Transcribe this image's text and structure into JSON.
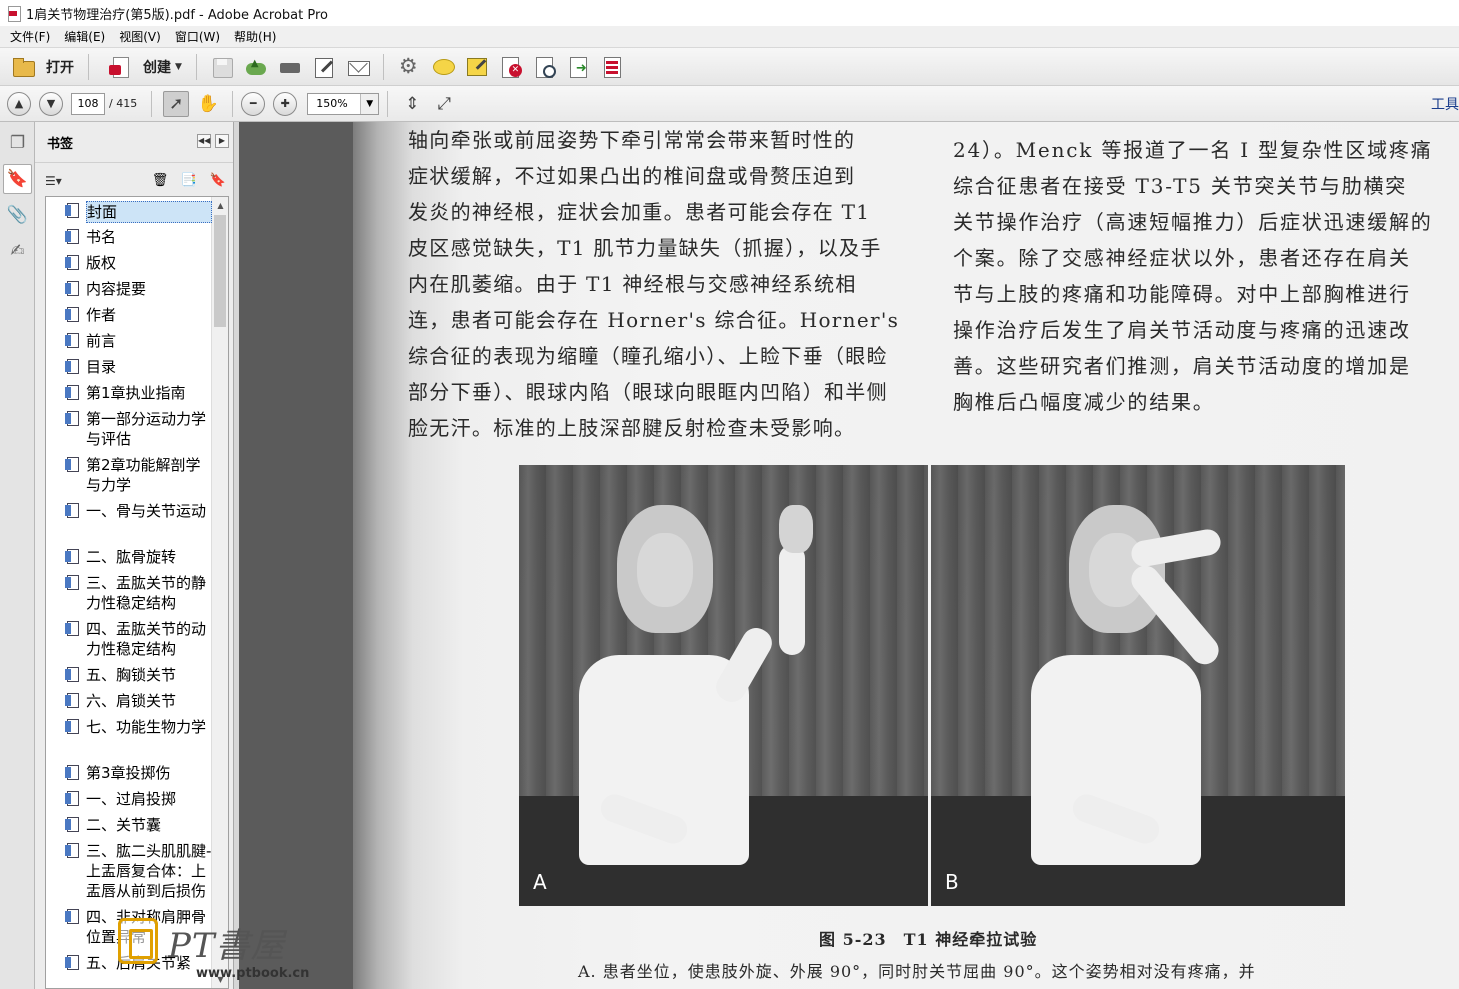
{
  "window": {
    "title": "1肩关节物理治疗(第5版).pdf - Adobe Acrobat Pro"
  },
  "menu": [
    "文件(F)",
    "编辑(E)",
    "视图(V)",
    "窗口(W)",
    "帮助(H)"
  ],
  "toolbar1": {
    "open_label": "打开",
    "create_label": "创建",
    "icons": [
      "save-icon",
      "cloud-upload-icon",
      "print-icon",
      "edit-icon",
      "mail-icon",
      "gear-icon",
      "comment-icon",
      "highlight-icon",
      "redact-icon",
      "search-doc-icon",
      "export-icon",
      "form-icon"
    ]
  },
  "toolbar2": {
    "page_current": "108",
    "page_total": "/ 415",
    "zoom": "150%",
    "tools_label": "工具"
  },
  "sidebar": {
    "title": "书签",
    "bookmarks": [
      {
        "label": "封面",
        "selected": true
      },
      {
        "label": "书名"
      },
      {
        "label": "版权"
      },
      {
        "label": "内容提要"
      },
      {
        "label": "作者"
      },
      {
        "label": "前言"
      },
      {
        "label": "目录"
      },
      {
        "label": "第1章执业指南"
      },
      {
        "label": "第一部分运动力学与评估"
      },
      {
        "label": "第2章功能解剖学与力学"
      },
      {
        "label": "一、骨与关节运动"
      },
      {
        "label": "二、肱骨旋转"
      },
      {
        "label": "三、盂肱关节的静力性稳定结构"
      },
      {
        "label": "四、盂肱关节的动力性稳定结构"
      },
      {
        "label": "五、胸锁关节"
      },
      {
        "label": "六、肩锁关节"
      },
      {
        "label": "七、功能生物力学"
      },
      {
        "label": "第3章投掷伤"
      },
      {
        "label": "一、过肩投掷"
      },
      {
        "label": "二、关节囊"
      },
      {
        "label": "三、肱二头肌肌腱-上盂唇复合体：上盂唇从前到后损伤"
      },
      {
        "label": "四、非对称肩胛骨位置异常"
      },
      {
        "label": "五、后肩关节紧"
      }
    ]
  },
  "document": {
    "left_column": [
      "轴向牵张或前屈姿势下牵引常常会带来暂时性的",
      "症状缓解，不过如果凸出的椎间盘或骨赘压迫到",
      "发炎的神经根，症状会加重。患者可能会存在 T1",
      "皮区感觉缺失，T1 肌节力量缺失（抓握），以及手",
      "内在肌萎缩。由于 T1 神经根与交感神经系统相",
      "连，患者可能会存在 Horner's 综合征。Horner's",
      "综合征的表现为缩瞳（瞳孔缩小）、上睑下垂（眼睑",
      "部分下垂）、眼球内陷（眼球向眼眶内凹陷）和半侧",
      "脸无汗。标准的上肢深部腱反射检查未受影响。"
    ],
    "right_column": [
      "24）。Menck 等报道了一名 I 型复杂性区域疼痛",
      "综合征患者在接受 T3-T5 关节突关节与肋横突",
      "关节操作治疗（高速短幅推力）后症状迅速缓解的",
      "个案。除了交感神经症状以外，患者还存在肩关",
      "节与上肢的疼痛和功能障碍。对中上部胸椎进行",
      "操作治疗后发生了肩关节活动度与疼痛的迅速改",
      "善。这些研究者们推测，肩关节活动度的增加是",
      "胸椎后凸幅度减少的结果。"
    ],
    "figure": {
      "panel_a": "A",
      "panel_b": "B",
      "caption": "图 5-23　T1 神经牵拉试验",
      "subcaption": "A. 患者坐位，使患肢外旋、外展 90°，同时肘关节屈曲 90°。这个姿势相对没有疼痛，并"
    }
  },
  "watermark": {
    "title": "PT書屋",
    "url": "www.ptbook.cn"
  }
}
